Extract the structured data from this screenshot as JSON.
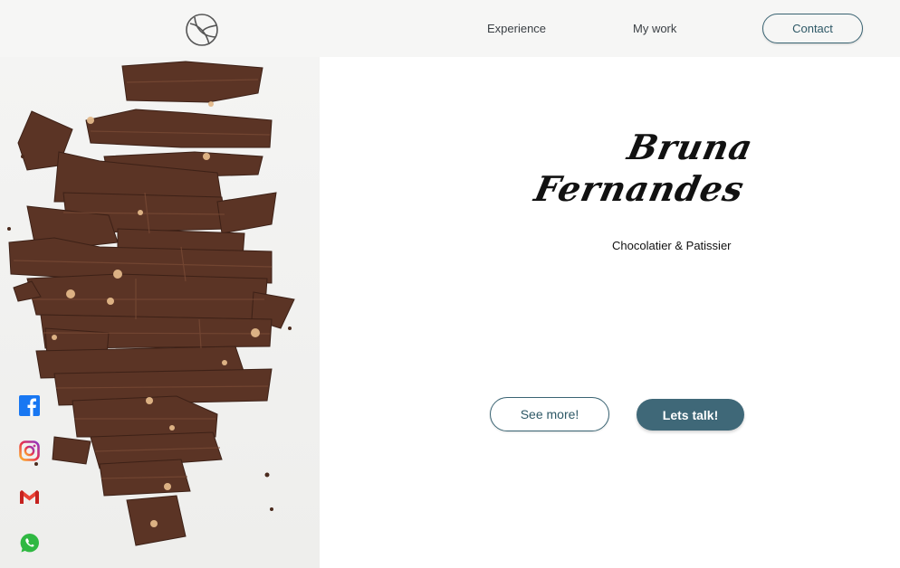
{
  "header": {
    "nav": {
      "experience": "Experience",
      "my_work": "My work"
    },
    "contact_label": "Contact"
  },
  "hero": {
    "first_name": "Bruna",
    "last_name": "Fernandes",
    "subtitle": "Chocolatier & Patissier",
    "see_more_label": "See more!",
    "lets_talk_label": "Lets talk!"
  },
  "social": [
    "facebook-icon",
    "instagram-icon",
    "gmail-icon",
    "whatsapp-icon"
  ],
  "colors": {
    "accent": "#3f6878",
    "header_bg": "#f6f6f5",
    "chocolate": "#5a3424"
  }
}
